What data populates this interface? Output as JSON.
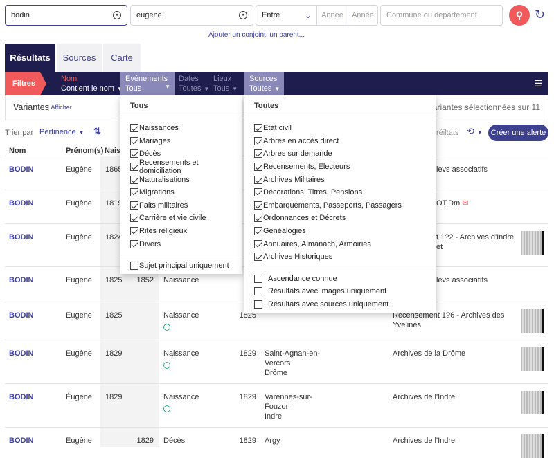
{
  "search": {
    "surname": "bodin",
    "firstname": "eugene",
    "date_mode": "Entre",
    "year_from_placeholder": "Année",
    "year_to_placeholder": "Année",
    "place_placeholder": "Commune ou département",
    "add_relative": "Ajouter un conjoint, un parent..."
  },
  "tabs": [
    "Résultats",
    "Sources",
    "Carte"
  ],
  "filters": {
    "label": "Filtres",
    "groups": [
      {
        "title": "Nom",
        "value": "Contient le nom"
      },
      {
        "title": "Evénements",
        "value": "Tous"
      },
      {
        "title": "Dates",
        "value": "Toutes"
      },
      {
        "title": "Lieux",
        "value": "Tous"
      },
      {
        "title": "Sources",
        "value": "Toutes"
      }
    ]
  },
  "variants": {
    "label": "Variantes",
    "link": "Afficher",
    "count_text": "11 ariantes sélectionnées sur 11"
  },
  "sort": {
    "label": "Trier par",
    "value": "Pertinence",
    "results_fragment": "réiltats",
    "alert_button": "Créer une alerte"
  },
  "columns": {
    "nom": "Nom",
    "prenom": "Prénom(s)",
    "naissance": "Naiss"
  },
  "events_menu": {
    "header": "Tous",
    "items": [
      {
        "label": "Naissances",
        "checked": true
      },
      {
        "label": "Mariages",
        "checked": true
      },
      {
        "label": "Décès",
        "checked": true
      },
      {
        "label": "Recensements et domiciliation",
        "checked": true
      },
      {
        "label": "Naturalisations",
        "checked": true
      },
      {
        "label": "Migrations",
        "checked": true
      },
      {
        "label": "Faits militaires",
        "checked": true
      },
      {
        "label": "Carrière et vie civile",
        "checked": true
      },
      {
        "label": "Rites religieux",
        "checked": true
      },
      {
        "label": "Divers",
        "checked": true
      }
    ],
    "extra": [
      {
        "label": "Sujet principal uniquement",
        "checked": false
      }
    ]
  },
  "sources_menu": {
    "header": "Toutes",
    "items": [
      {
        "label": "Etat civil",
        "checked": true
      },
      {
        "label": "Arbres en accès direct",
        "checked": true
      },
      {
        "label": "Arbres sur demande",
        "checked": true
      },
      {
        "label": "Recensements, Electeurs",
        "checked": true
      },
      {
        "label": "Archives Militaires",
        "checked": true
      },
      {
        "label": "Décorations, Titres, Pensions",
        "checked": true
      },
      {
        "label": "Embarquements, Passeports, Passagers",
        "checked": true
      },
      {
        "label": "Ordonnances et Décrets",
        "checked": true
      },
      {
        "label": "Généalogies",
        "checked": true
      },
      {
        "label": "Annuaires, Almanach, Armoiries",
        "checked": true
      },
      {
        "label": "Archives Historiques",
        "checked": true
      }
    ],
    "extra": [
      {
        "label": "Ascendance connue",
        "checked": false
      },
      {
        "label": "Résultats avec images uniquement",
        "checked": false
      },
      {
        "label": "Résultats avec sources uniquement",
        "checked": false
      }
    ]
  },
  "rows": [
    {
      "nom": "BODIN",
      "prenom": "Eugène",
      "birth": "1865",
      "death": "",
      "event": "",
      "verified": false,
      "year": "",
      "place": "",
      "source": "levs associatifs",
      "source_partial": true,
      "thumb": false,
      "mail": false
    },
    {
      "nom": "BODIN",
      "prenom": "Eugène",
      "birth": "1819",
      "death": "",
      "event": "",
      "verified": false,
      "year": "",
      "place": "",
      "source": "OT.Dm",
      "source_partial": true,
      "thumb": false,
      "mail": true
    },
    {
      "nom": "BODIN",
      "prenom": "Eugène",
      "birth": "1824",
      "death": "",
      "event": "",
      "verified": false,
      "year": "",
      "place": "",
      "source": "t 1?2 - Archives d'Indre et",
      "source_partial": true,
      "thumb": true,
      "mail": false
    },
    {
      "nom": "BODIN",
      "prenom": "Eugène",
      "birth": "1825",
      "death": "1852",
      "event": "Naissance",
      "verified": false,
      "year": "",
      "place": "",
      "source": "levs associatifs",
      "source_partial": true,
      "thumb": false,
      "mail": false
    },
    {
      "nom": "BODIN",
      "prenom": "Eugene",
      "birth": "1825",
      "death": "",
      "event": "Naissance",
      "verified": true,
      "year": "1825",
      "place": "",
      "source": "Recensement 1?6 - Archives des\nYvelines",
      "source_partial": false,
      "thumb": true,
      "mail": false
    },
    {
      "nom": "BODIN",
      "prenom": "Eugène",
      "birth": "1829",
      "death": "",
      "event": "Naissance",
      "verified": true,
      "year": "1829",
      "place": "Saint-Agnan-en-\nVercors\nDrôme",
      "source": "Archives de la Drôme",
      "source_partial": false,
      "thumb": true,
      "mail": false
    },
    {
      "nom": "BODIN",
      "prenom": "Éugene",
      "birth": "1829",
      "death": "",
      "event": "Naissance",
      "verified": true,
      "year": "1829",
      "place": "Varennes-sur-\nFouzon\nIndre",
      "source": "Archives de l'Indre",
      "source_partial": false,
      "thumb": true,
      "mail": false
    },
    {
      "nom": "BODIN",
      "prenom": "Eugène",
      "birth": "",
      "death": "1829",
      "event": "Décès",
      "verified": false,
      "year": "1829",
      "place": "Argy",
      "source": "Archives de l'Indre",
      "source_partial": false,
      "thumb": true,
      "mail": false
    }
  ],
  "colors": {
    "navy": "#1f1d4e",
    "accent": "#f05a5a",
    "link": "#3d3f9f",
    "open_filter": "#8a88b8",
    "verified": "#2bb38a"
  }
}
